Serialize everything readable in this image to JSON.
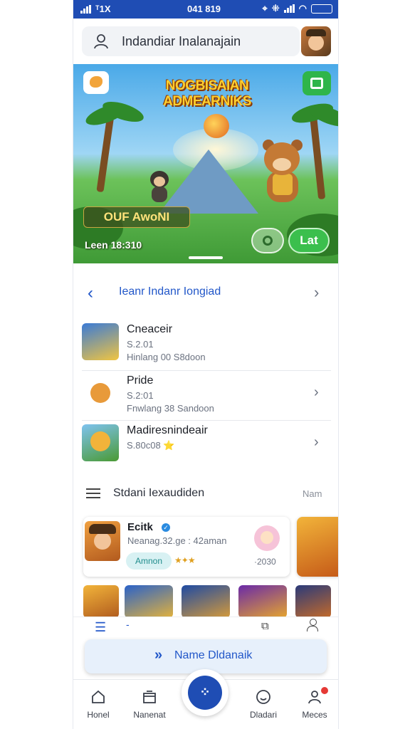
{
  "status": {
    "left": "ᵀ1X",
    "time": "041 819",
    "battery": ""
  },
  "search": {
    "label": "Indandiar Inalanajain"
  },
  "hero": {
    "title_art": "NOGBISAIAN ADMEARNIKS",
    "offer": "OUF AwoNI",
    "date": "Leen 18:310",
    "cta": "Lat"
  },
  "section1": {
    "title": "Ieanr Indanr Iongiad"
  },
  "list": [
    {
      "name": "Cneaceir",
      "sub1": "S.2.01",
      "sub2": "Hinlang  00    S8doon"
    },
    {
      "name": "Pride",
      "sub1": "S.2:01",
      "sub2": "Fnwlang  38    Sandoon"
    },
    {
      "name": "Madiresnindeair",
      "sub1": "S.80c08 ⭐",
      "sub2": ""
    }
  ],
  "section2": {
    "title": "Stdani Iexaudiden",
    "more": "Nam"
  },
  "card": {
    "name": "Ecitk",
    "meta": "Neanag.32.ge : 42aman",
    "tag": "Amnon",
    "stars": "★✦★",
    "price": "·2030"
  },
  "float_action": {
    "label": "Name Dldanaik",
    "icon": "»"
  },
  "tabs": [
    {
      "label": "Honel",
      "icon": "home-icon"
    },
    {
      "label": "Nanenat",
      "icon": "store-icon"
    },
    {
      "label": "Dladari",
      "icon": "smiley-icon"
    },
    {
      "label": "Meces",
      "icon": "profile-icon"
    }
  ],
  "colors": {
    "primary": "#1f4db4",
    "accent": "#2257c9",
    "green": "#3bbf4d"
  }
}
